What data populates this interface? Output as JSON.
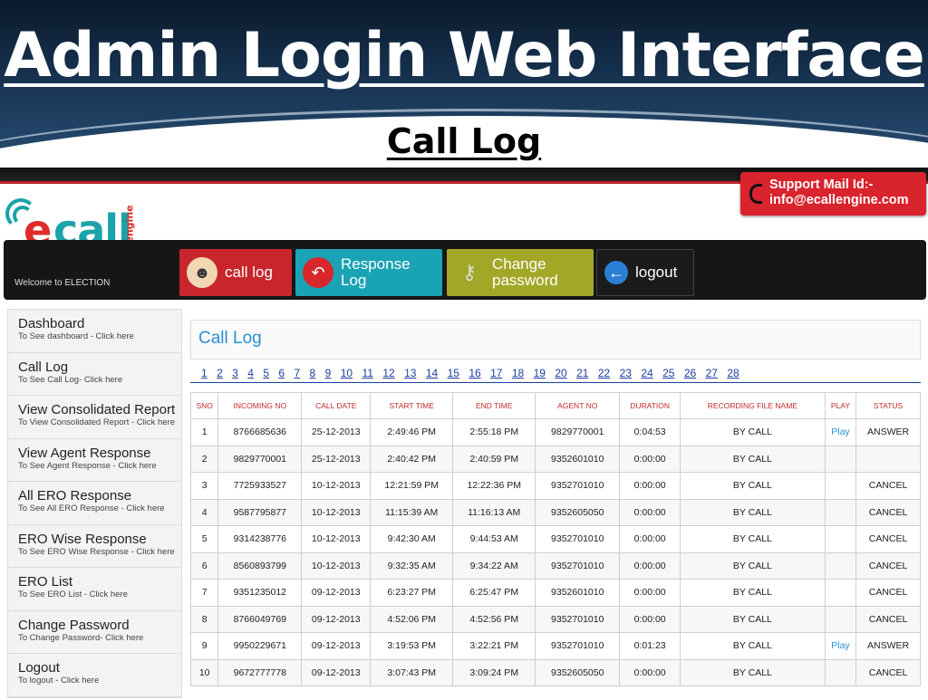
{
  "slide": {
    "title": "Admin Login Web Interface",
    "subtitle": "Call Log"
  },
  "support": {
    "line1": "Support Mail Id:-",
    "line2": "info@ecallengine.com"
  },
  "logo": {
    "e": "e",
    "call": "call",
    "engine": "engine"
  },
  "welcome": "Welcome to ELECTION",
  "nav": {
    "call_log": "call log",
    "response_log_1": "Response",
    "response_log_2": "Log",
    "change_password_1": "Change",
    "change_password_2": "password",
    "logout": "logout"
  },
  "sidebar": [
    {
      "title": "Dashboard",
      "sub": "To See dashboard - Click here"
    },
    {
      "title": "Call Log",
      "sub": "To See Call Log- Click here"
    },
    {
      "title": "View Consolidated Report",
      "sub": "To View Consolidated Report - Click here"
    },
    {
      "title": "View Agent Response",
      "sub": "To See Agent Response - Click here"
    },
    {
      "title": "All ERO Response",
      "sub": "To See All ERO Response - Click here"
    },
    {
      "title": "ERO Wise Response",
      "sub": "To See ERO Wise Response - Click here"
    },
    {
      "title": "ERO List",
      "sub": "To See ERO List - Click here"
    },
    {
      "title": "Change Password",
      "sub": "To Change Password- Click here"
    },
    {
      "title": "Logout",
      "sub": "To logout - Click here"
    }
  ],
  "panel_title": "Call Log",
  "pages": [
    "1",
    "2",
    "3",
    "4",
    "5",
    "6",
    "7",
    "8",
    "9",
    "10",
    "11",
    "12",
    "13",
    "14",
    "15",
    "16",
    "17",
    "18",
    "19",
    "20",
    "21",
    "22",
    "23",
    "24",
    "25",
    "26",
    "27",
    "28"
  ],
  "table": {
    "headers": [
      "SNO",
      "INCOMING NO",
      "CALL DATE",
      "START TIME",
      "END TIME",
      "AGENT NO",
      "DURATION",
      "RECORDING FILE NAME",
      "PLAY",
      "STATUS"
    ],
    "rows": [
      [
        "1",
        "8766685636",
        "25-12-2013",
        "2:49:46 PM",
        "2:55:18 PM",
        "9829770001",
        "0:04:53",
        "BY CALL",
        "Play",
        "ANSWER"
      ],
      [
        "2",
        "9829770001",
        "25-12-2013",
        "2:40:42 PM",
        "2:40:59 PM",
        "9352601010",
        "0:00:00",
        "BY CALL",
        "",
        ""
      ],
      [
        "3",
        "7725933527",
        "10-12-2013",
        "12:21:59 PM",
        "12:22:36 PM",
        "9352701010",
        "0:00:00",
        "BY CALL",
        "",
        "CANCEL"
      ],
      [
        "4",
        "9587795877",
        "10-12-2013",
        "11:15:39 AM",
        "11:16:13 AM",
        "9352605050",
        "0:00:00",
        "BY CALL",
        "",
        "CANCEL"
      ],
      [
        "5",
        "9314238776",
        "10-12-2013",
        "9:42:30 AM",
        "9:44:53 AM",
        "9352701010",
        "0:00:00",
        "BY CALL",
        "",
        "CANCEL"
      ],
      [
        "6",
        "8560893799",
        "10-12-2013",
        "9:32:35 AM",
        "9:34:22 AM",
        "9352701010",
        "0:00:00",
        "BY CALL",
        "",
        "CANCEL"
      ],
      [
        "7",
        "9351235012",
        "09-12-2013",
        "6:23:27 PM",
        "6:25:47 PM",
        "9352601010",
        "0:00:00",
        "BY CALL",
        "",
        "CANCEL"
      ],
      [
        "8",
        "8766049769",
        "09-12-2013",
        "4:52:06 PM",
        "4:52:56 PM",
        "9352701010",
        "0:00:00",
        "BY CALL",
        "",
        "CANCEL"
      ],
      [
        "9",
        "9950229671",
        "09-12-2013",
        "3:19:53 PM",
        "3:22:21 PM",
        "9352701010",
        "0:01:23",
        "BY CALL",
        "Play",
        "ANSWER"
      ],
      [
        "10",
        "9672777778",
        "09-12-2013",
        "3:07:43 PM",
        "3:09:24 PM",
        "9352605050",
        "0:00:00",
        "BY CALL",
        "",
        "CANCEL"
      ]
    ]
  }
}
